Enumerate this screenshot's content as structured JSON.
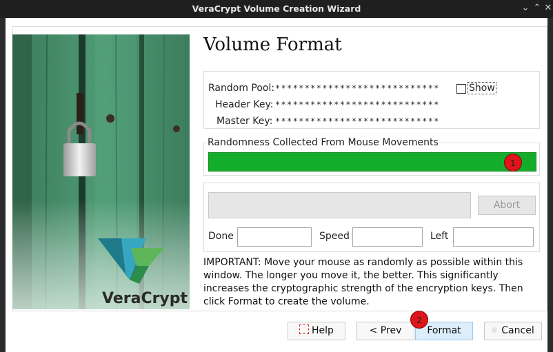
{
  "window": {
    "title": "VeraCrypt Volume Creation Wizard",
    "controls": [
      "minimize-icon",
      "maximize-icon",
      "close-icon"
    ]
  },
  "sidebar": {
    "brand": "VeraCrypt"
  },
  "page": {
    "heading": "Volume Format"
  },
  "keys": {
    "random_pool_label": "Random Pool:",
    "random_pool_value": "****************************",
    "header_key_label": "Header Key:",
    "header_key_value": "****************************",
    "master_key_label": "Master Key:",
    "master_key_value": "****************************",
    "show_label": "Show",
    "show_checked": false
  },
  "randomness": {
    "label": "Randomness Collected From Mouse Movements",
    "progress_fraction": 1.0,
    "bar_color": "#14ad2b"
  },
  "format_progress": {
    "abort_label": "Abort",
    "done_label": "Done",
    "done_value": "",
    "speed_label": "Speed",
    "speed_value": "",
    "left_label": "Left",
    "left_value": ""
  },
  "important_text": "IMPORTANT: Move your mouse as randomly as possible within this window. The longer you move it, the better. This significantly increases the cryptographic strength of the encryption keys. Then click Format to create the volume.",
  "annotations": {
    "marker_1": "1",
    "marker_2": "2",
    "marker_color": "#e0141b"
  },
  "buttons": {
    "help": "Help",
    "prev": "< Prev",
    "format": "Format",
    "cancel": "Cancel"
  }
}
